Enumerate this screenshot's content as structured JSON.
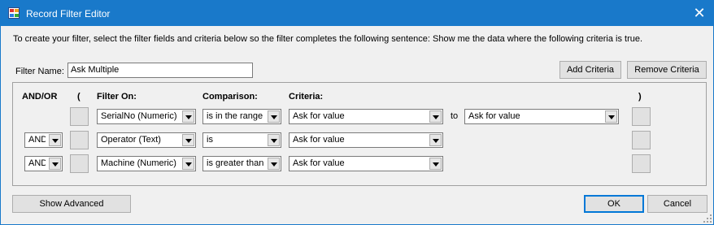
{
  "window": {
    "title": "Record Filter Editor",
    "close_label": "✕"
  },
  "instruction": "To create your filter, select the filter fields and criteria below so the filter completes the following sentence: Show me the data where the following criteria is true.",
  "filter_name": {
    "label": "Filter Name:",
    "value": "Ask Multiple"
  },
  "buttons": {
    "add_criteria": "Add Criteria",
    "remove_criteria": "Remove Criteria",
    "show_advanced": "Show Advanced",
    "ok": "OK",
    "cancel": "Cancel"
  },
  "headers": {
    "andor": "AND/OR",
    "open_paren": "(",
    "filter_on": "Filter On:",
    "comparison": "Comparison:",
    "criteria": "Criteria:",
    "close_paren": ")"
  },
  "rows": [
    {
      "andor": "",
      "field": "SerialNo (Numeric)",
      "comparison": "is in the range",
      "criteria": "Ask for value",
      "to_label": "to",
      "criteria2": "Ask for value"
    },
    {
      "andor": "AND",
      "field": "Operator (Text)",
      "comparison": "is",
      "criteria": "Ask for value"
    },
    {
      "andor": "AND",
      "field": "Machine (Numeric)",
      "comparison": "is greater than o",
      "criteria": "Ask for value"
    }
  ]
}
